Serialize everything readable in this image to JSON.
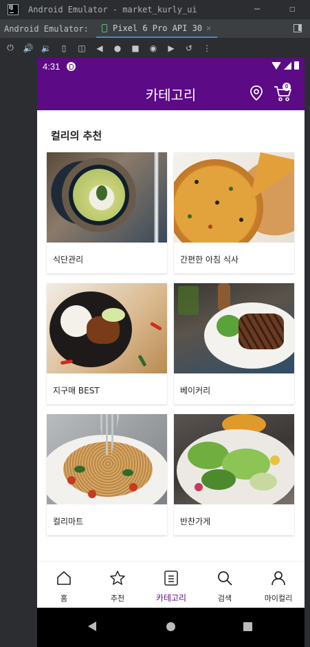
{
  "ide": {
    "window_title": "Android Emulator - market_kurly_ui",
    "minimize": "—",
    "maximize": "☐",
    "panel_label": "Android Emulator:",
    "device_tab": "Pixel 6 Pro API 30",
    "tab_close": "×",
    "toolbar_icons": [
      "power-icon",
      "volume-up-icon",
      "volume-down-icon",
      "rotate-left-icon",
      "rotate-right-icon",
      "back-icon",
      "home-icon",
      "overview-icon",
      "camera-icon",
      "record-icon",
      "reset-icon",
      "more-icon"
    ]
  },
  "status": {
    "time": "4:31"
  },
  "appbar": {
    "title": "카테고리",
    "cart_count": "0",
    "accent": "#5c0a86"
  },
  "section": {
    "title": "컬리의 추천"
  },
  "cards": [
    {
      "label": "식단관리",
      "image": "cream-soup-photo"
    },
    {
      "label": "간편한 아침 식사",
      "image": "pizza-photo"
    },
    {
      "label": "지구매 BEST",
      "image": "rice-plate-photo"
    },
    {
      "label": "베이커리",
      "image": "steak-plate-photo"
    },
    {
      "label": "컬리마트",
      "image": "pasta-photo"
    },
    {
      "label": "반찬가게",
      "image": "salad-photo"
    }
  ],
  "bottom_nav": [
    {
      "label": "홈",
      "icon": "home-icon",
      "active": false
    },
    {
      "label": "추천",
      "icon": "star-icon",
      "active": false
    },
    {
      "label": "카테고리",
      "icon": "list-icon",
      "active": true
    },
    {
      "label": "검색",
      "icon": "search-icon",
      "active": false
    },
    {
      "label": "마이컬리",
      "icon": "person-icon",
      "active": false
    }
  ]
}
